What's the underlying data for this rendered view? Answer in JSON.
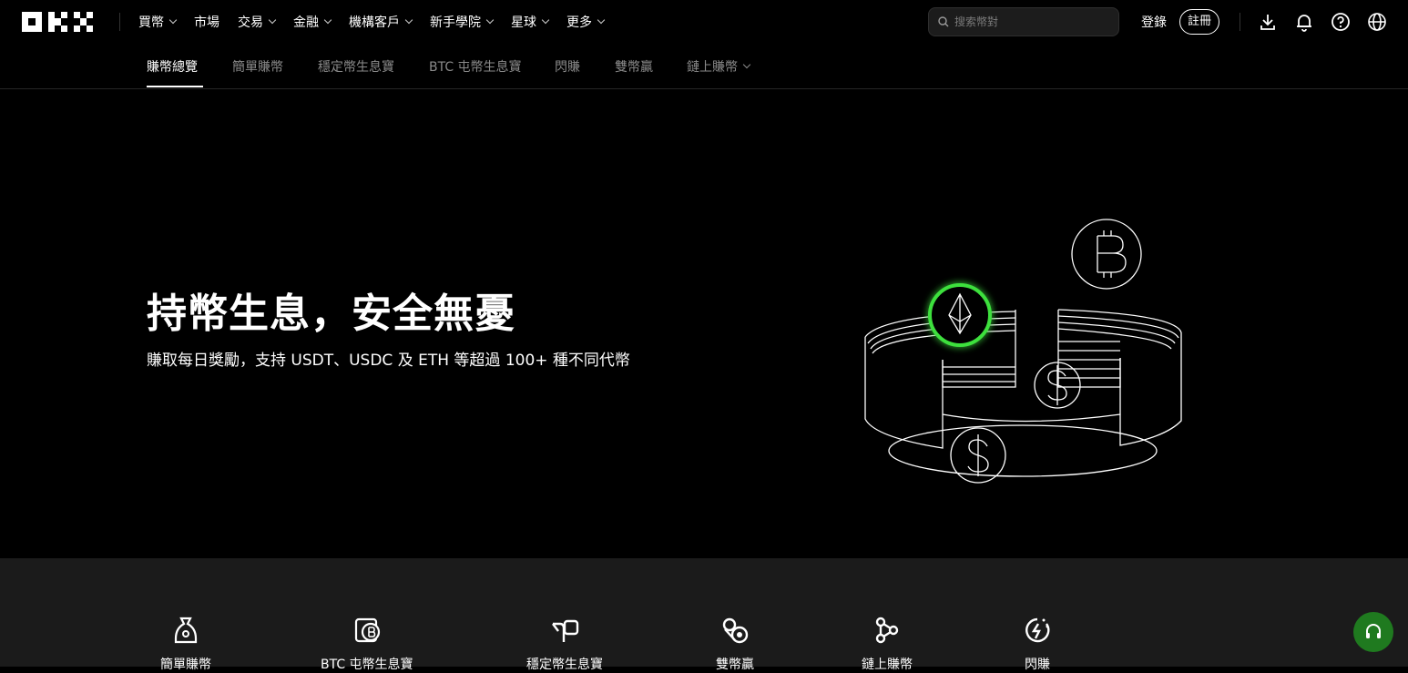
{
  "header": {
    "nav": [
      {
        "label": "買幣",
        "dropdown": true
      },
      {
        "label": "市場",
        "dropdown": false
      },
      {
        "label": "交易",
        "dropdown": true
      },
      {
        "label": "金融",
        "dropdown": true
      },
      {
        "label": "機構客戶",
        "dropdown": true
      },
      {
        "label": "新手學院",
        "dropdown": true
      },
      {
        "label": "星球",
        "dropdown": true
      },
      {
        "label": "更多",
        "dropdown": true
      }
    ],
    "search_placeholder": "搜索幣對",
    "login_label": "登錄",
    "signup_label": "註冊",
    "icons": [
      "download-icon",
      "bell-icon",
      "help-icon",
      "globe-icon"
    ]
  },
  "subnav": {
    "tabs": [
      {
        "label": "賺幣總覽",
        "active": true
      },
      {
        "label": "簡單賺幣",
        "active": false
      },
      {
        "label": "穩定幣生息寶",
        "active": false
      },
      {
        "label": "BTC 屯幣生息寶",
        "active": false
      },
      {
        "label": "閃賺",
        "active": false
      },
      {
        "label": "雙幣贏",
        "active": false
      },
      {
        "label": "鏈上賺幣",
        "active": false,
        "dropdown": true
      }
    ]
  },
  "hero": {
    "title": "持幣生息，安全無憂",
    "subtitle": "賺取每日獎勵，支持 USDT、USDC 及 ETH 等超過 100+ 種不同代幣"
  },
  "products": [
    {
      "label": "簡單賺幣",
      "icon": "money-bag-icon"
    },
    {
      "label": "BTC 屯幣生息寶",
      "icon": "btc-vault-icon"
    },
    {
      "label": "穩定幣生息寶",
      "icon": "stable-coin-icon"
    },
    {
      "label": "雙幣贏",
      "icon": "dual-coin-icon"
    },
    {
      "label": "鏈上賺幣",
      "icon": "onchain-icon"
    },
    {
      "label": "閃賺",
      "icon": "flash-icon"
    }
  ],
  "colors": {
    "accent_green": "#3ee03e",
    "background": "#000000",
    "panel": "#1b1b1b",
    "support": "#1f7a1f"
  }
}
